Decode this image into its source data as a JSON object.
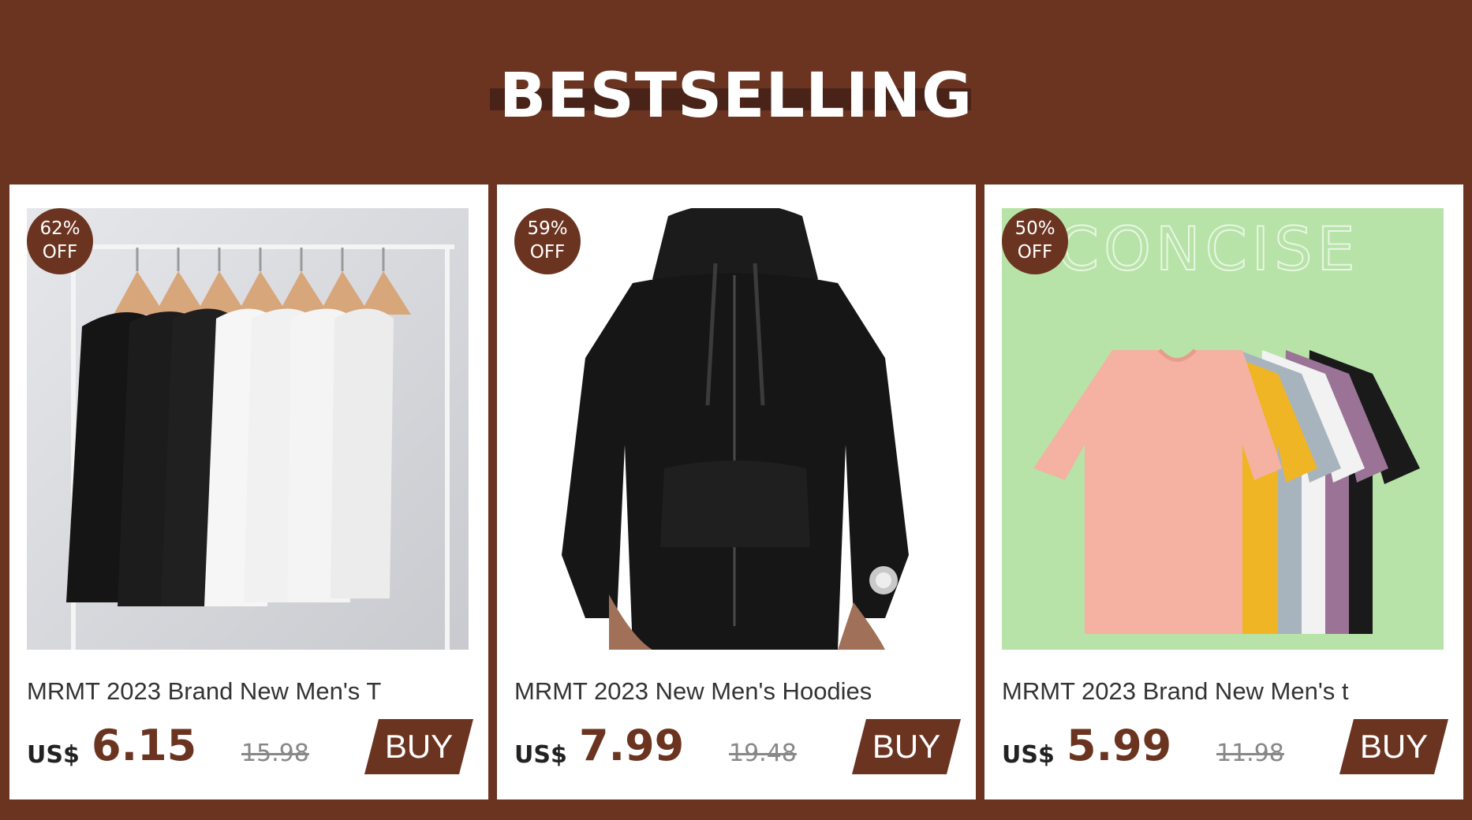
{
  "header": {
    "title": "BESTSELLING"
  },
  "products": [
    {
      "name": "MRMT 2023 Brand New Men's T",
      "discount_pct": "62%",
      "discount_off": "OFF",
      "currency": "US$",
      "price": "6.15",
      "old_price": "15.98",
      "buy_label": "BUY",
      "image": "shirts-on-rack"
    },
    {
      "name": "MRMT 2023 New Men's Hoodies",
      "discount_pct": "59%",
      "discount_off": "OFF",
      "currency": "US$",
      "price": "7.99",
      "old_price": "19.48",
      "buy_label": "BUY",
      "image": "black-hoodie"
    },
    {
      "name": "MRMT 2023 Brand New Men's t",
      "discount_pct": "50%",
      "discount_off": "OFF",
      "currency": "US$",
      "price": "5.99",
      "old_price": "11.98",
      "buy_label": "BUY",
      "image": "tshirt-stack",
      "image_text": "CONCISE"
    }
  ],
  "colors": {
    "brand": "#6b3421",
    "card_bg": "#ffffff",
    "green_bg": "#b7e3a8"
  }
}
